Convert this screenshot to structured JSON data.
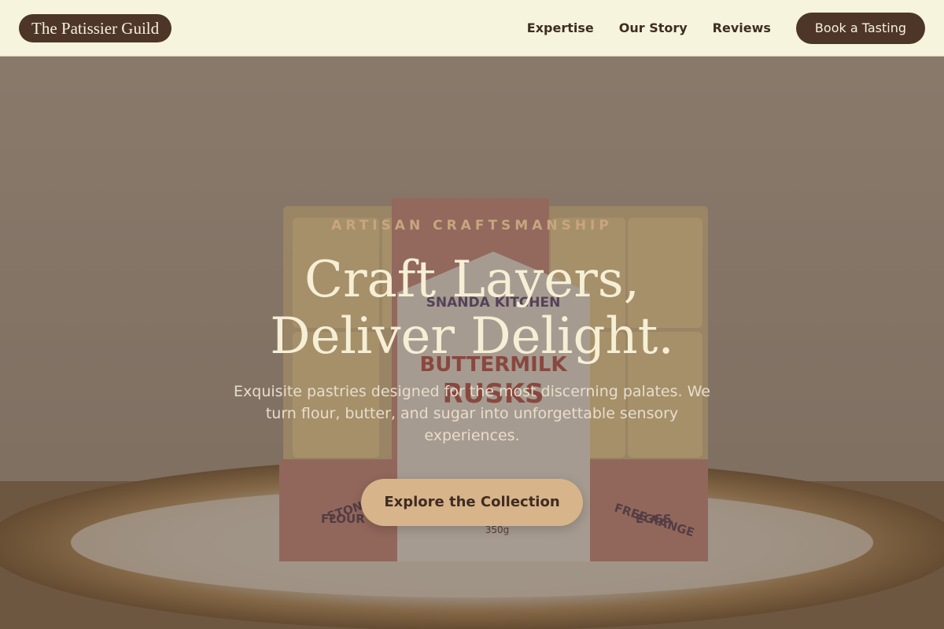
{
  "header": {
    "brand": "The Patissier Guild",
    "nav": [
      {
        "label": "Expertise"
      },
      {
        "label": "Our Story"
      },
      {
        "label": "Reviews"
      }
    ],
    "cta": "Book a Tasting"
  },
  "hero": {
    "eyebrow": "ARTISAN CRAFTSMANSHIP",
    "headline_line1": "Craft Layers,",
    "headline_line2": "Deliver Delight.",
    "subtext": "Exquisite pastries designed for the most discerning palates. We turn flour, butter, and sugar into unforgettable sensory experiences.",
    "cta": "Explore the Collection",
    "background_image": {
      "package_brand": "SNANDA KITCHEN",
      "package_product": "BUTTERMILK RUSKS",
      "side_label_left": "STONEGROUND FLOUR",
      "side_label_right": "FREE RANGE EGGS",
      "weight": "350g"
    }
  },
  "colors": {
    "header_bg": "#f6f4dc",
    "brand_dark": "#4d3627",
    "accent_tan": "#d8b48a",
    "eyebrow": "#c9a57f",
    "headline": "#f6efd5"
  }
}
